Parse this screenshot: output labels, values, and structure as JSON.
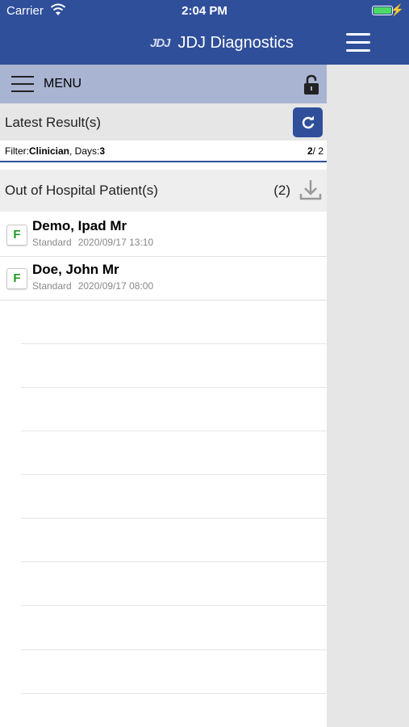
{
  "status": {
    "carrier": "Carrier",
    "time": "2:04 PM"
  },
  "app": {
    "logo": "JDJ",
    "title": "JDJ Diagnostics"
  },
  "menu": {
    "label": "MENU"
  },
  "latest": {
    "label": "Latest Result(s)"
  },
  "filter": {
    "prefix": "Filter:",
    "clinician": "Clinician",
    "days_prefix": ", Days:",
    "days": "3",
    "page_current": "2",
    "page_total": "/ 2"
  },
  "group": {
    "label": "Out of Hospital Patient(s)",
    "count": "(2)"
  },
  "patients": [
    {
      "badge": "F",
      "name": "Demo, Ipad Mr",
      "type": "Standard",
      "datetime": "2020/09/17 13:10"
    },
    {
      "badge": "F",
      "name": "Doe, John Mr",
      "type": "Standard",
      "datetime": "2020/09/17 08:00"
    }
  ],
  "colors": {
    "header": "#2f4f9a",
    "menu_bar": "#a9b4d2",
    "badge_text": "#1f9a1f"
  }
}
